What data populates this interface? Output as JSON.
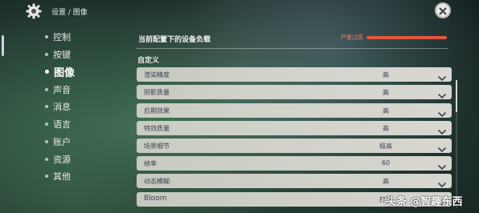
{
  "header": {
    "breadcrumb": "设置 / 图像",
    "close_icon": "close-icon",
    "gear_icon": "gear-icon"
  },
  "sidebar": {
    "items": [
      {
        "label": "控制",
        "active": false
      },
      {
        "label": "按键",
        "active": false
      },
      {
        "label": "图像",
        "active": true
      },
      {
        "label": "声音",
        "active": false
      },
      {
        "label": "消息",
        "active": false
      },
      {
        "label": "语言",
        "active": false
      },
      {
        "label": "账户",
        "active": false
      },
      {
        "label": "资源",
        "active": false
      },
      {
        "label": "其他",
        "active": false
      }
    ]
  },
  "device_load": {
    "title": "当前配置下的设备负载",
    "status": "严重过高",
    "status_color": "#e2573f"
  },
  "custom": {
    "section_title": "自定义",
    "rows": [
      {
        "name": "渲染精度",
        "value": "高"
      },
      {
        "name": "阴影质量",
        "value": "高"
      },
      {
        "name": "后期效果",
        "value": "高"
      },
      {
        "name": "特效质量",
        "value": "高"
      },
      {
        "name": "场景细节",
        "value": "极高"
      },
      {
        "name": "帧率",
        "value": "60"
      },
      {
        "name": "动态模糊",
        "value": "高"
      },
      {
        "name": "Bloom",
        "value": "打开"
      }
    ]
  },
  "watermark": "头条 @智趣东西",
  "colors": {
    "row_bg": "#e9e6df",
    "row_text": "#3b4150",
    "accent_red": "#e2573f"
  }
}
